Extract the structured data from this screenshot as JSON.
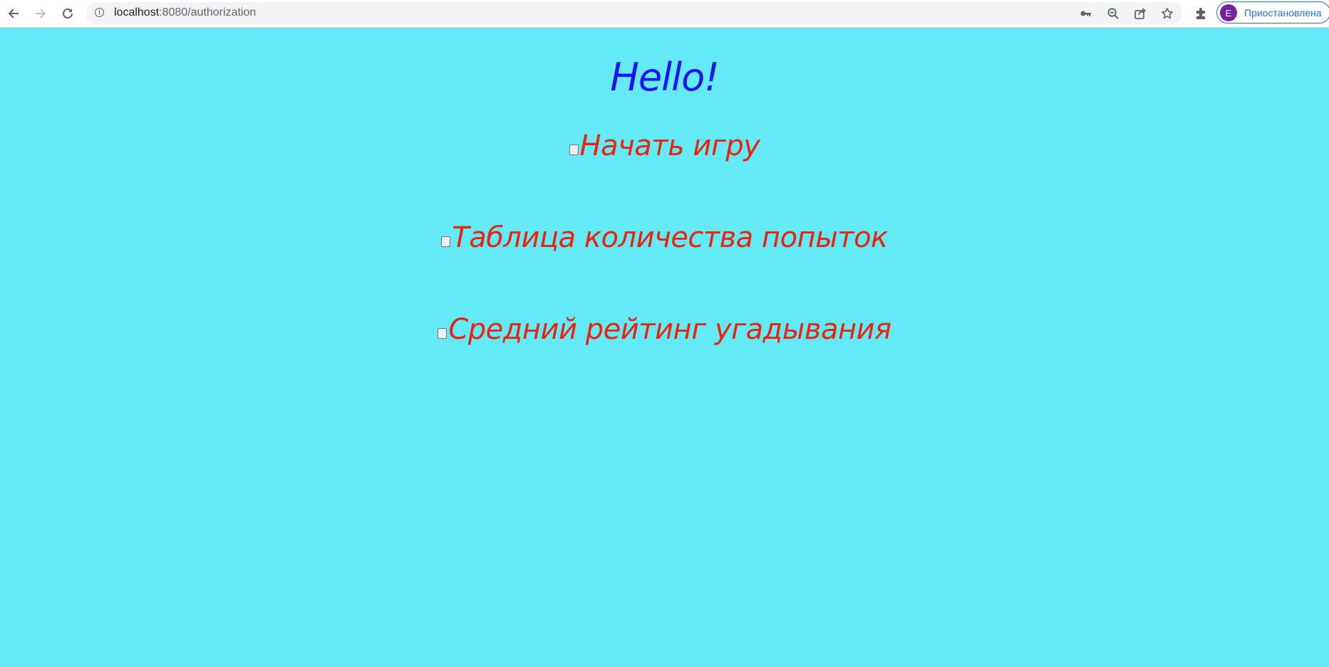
{
  "browser": {
    "url_host": "localhost",
    "url_path": ":8080/authorization",
    "profile_initial": "E",
    "profile_status": "Приостановлена"
  },
  "page": {
    "heading": "Hello!",
    "menu": [
      {
        "label": "Начать игру",
        "checked": false
      },
      {
        "label": "Таблица количества попыток",
        "checked": false
      },
      {
        "label": "Средний рейтинг угадывания",
        "checked": false
      }
    ]
  },
  "colors": {
    "background": "#64e9f6",
    "heading": "#1a12f0",
    "menu_text": "#e8260f",
    "profile_accent": "#1a73e8",
    "avatar": "#7b1fa2"
  },
  "icons": [
    "back-arrow-icon",
    "forward-arrow-icon",
    "reload-icon",
    "info-icon",
    "key-icon",
    "zoom-out-icon",
    "share-icon",
    "star-icon",
    "extensions-icon"
  ]
}
